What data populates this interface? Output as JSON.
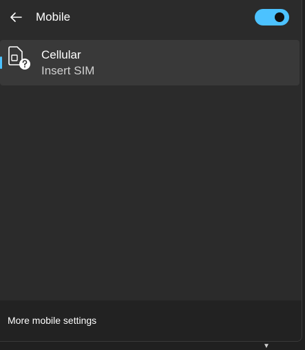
{
  "header": {
    "title": "Mobile",
    "back_icon": "arrow-left-icon",
    "toggle_state": "on"
  },
  "item": {
    "title": "Cellular",
    "subtitle": "Insert SIM",
    "icon": "sim-question-icon"
  },
  "footer": {
    "link_label": "More mobile settings"
  },
  "colors": {
    "accent": "#4cc2ff",
    "panel": "#2b2b2b",
    "item_bg": "#393939",
    "footer_bg": "#222222"
  }
}
